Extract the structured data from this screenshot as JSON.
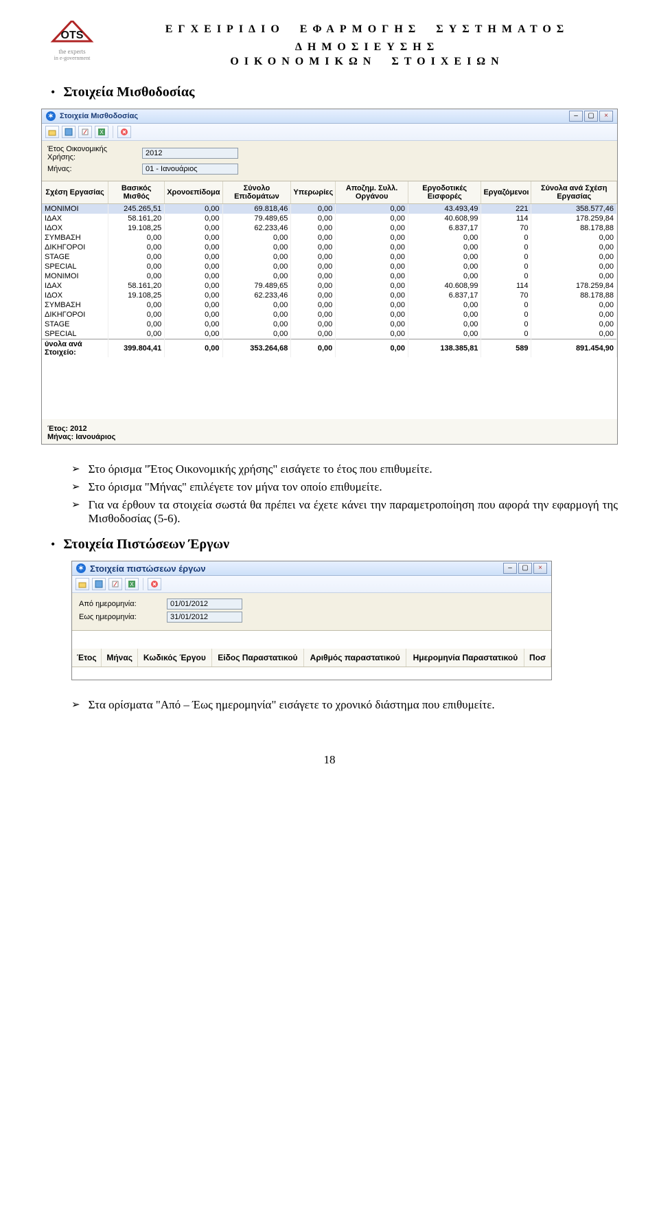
{
  "header": {
    "logo_sub1": "the experts",
    "logo_sub2": "in e-government",
    "title_line1": "ΕΓΧΕΙΡΙΔΙΟ ΕΦΑΡΜΟΓΗΣ ΣΥΣΤΗΜΑΤΟΣ ΔΗΜΟΣΙΕΥΣΗΣ",
    "title_line2": "ΟΙΚΟΝΟΜΙΚΩΝ ΣΤΟΙΧΕΙΩΝ"
  },
  "section1": {
    "heading": "Στοιχεία Μισθοδοσίας"
  },
  "screenshot1": {
    "title": "Στοιχεία Μισθοδοσίας",
    "form": {
      "year_label": "Έτος Οικονομικής Χρήσης:",
      "year_value": "2012",
      "month_label": "Μήνας:",
      "month_value": "01 - Ιανουάριος"
    },
    "columns": [
      "Σχέση Εργασίας",
      "Βασικός Μισθός",
      "Χρονοεπίδομα",
      "Σύνολο Επιδομάτων",
      "Υπερωρίες",
      "Αποζημ. Συλλ. Οργάνου",
      "Εργοδοτικές Εισφορές",
      "Εργαζόμενοι",
      "Σύνολα ανά Σχέση Εργασίας"
    ],
    "rows": [
      {
        "c": [
          "ΜΟΝΙΜΟΙ",
          "245.265,51",
          "0,00",
          "69.818,46",
          "0,00",
          "0,00",
          "43.493,49",
          "221",
          "358.577,46"
        ],
        "sel": true
      },
      {
        "c": [
          "ΙΔΑΧ",
          "58.161,20",
          "0,00",
          "79.489,65",
          "0,00",
          "0,00",
          "40.608,99",
          "114",
          "178.259,84"
        ]
      },
      {
        "c": [
          "ΙΔΟΧ",
          "19.108,25",
          "0,00",
          "62.233,46",
          "0,00",
          "0,00",
          "6.837,17",
          "70",
          "88.178,88"
        ]
      },
      {
        "c": [
          "ΣΥΜΒΑΣΗ",
          "0,00",
          "0,00",
          "0,00",
          "0,00",
          "0,00",
          "0,00",
          "0",
          "0,00"
        ]
      },
      {
        "c": [
          "ΔΙΚΗΓΟΡΟΙ",
          "0,00",
          "0,00",
          "0,00",
          "0,00",
          "0,00",
          "0,00",
          "0",
          "0,00"
        ]
      },
      {
        "c": [
          "STAGE",
          "0,00",
          "0,00",
          "0,00",
          "0,00",
          "0,00",
          "0,00",
          "0",
          "0,00"
        ]
      },
      {
        "c": [
          "SPECIAL",
          "0,00",
          "0,00",
          "0,00",
          "0,00",
          "0,00",
          "0,00",
          "0",
          "0,00"
        ]
      },
      {
        "c": [
          "ΜΟΝΙΜΟΙ",
          "0,00",
          "0,00",
          "0,00",
          "0,00",
          "0,00",
          "0,00",
          "0",
          "0,00"
        ]
      },
      {
        "c": [
          "ΙΔΑΧ",
          "58.161,20",
          "0,00",
          "79.489,65",
          "0,00",
          "0,00",
          "40.608,99",
          "114",
          "178.259,84"
        ]
      },
      {
        "c": [
          "ΙΔΟΧ",
          "19.108,25",
          "0,00",
          "62.233,46",
          "0,00",
          "0,00",
          "6.837,17",
          "70",
          "88.178,88"
        ]
      },
      {
        "c": [
          "ΣΥΜΒΑΣΗ",
          "0,00",
          "0,00",
          "0,00",
          "0,00",
          "0,00",
          "0,00",
          "0",
          "0,00"
        ]
      },
      {
        "c": [
          "ΔΙΚΗΓΟΡΟΙ",
          "0,00",
          "0,00",
          "0,00",
          "0,00",
          "0,00",
          "0,00",
          "0",
          "0,00"
        ]
      },
      {
        "c": [
          "STAGE",
          "0,00",
          "0,00",
          "0,00",
          "0,00",
          "0,00",
          "0,00",
          "0",
          "0,00"
        ]
      },
      {
        "c": [
          "SPECIAL",
          "0,00",
          "0,00",
          "0,00",
          "0,00",
          "0,00",
          "0,00",
          "0",
          "0,00"
        ]
      }
    ],
    "sum_label": "ύνολα ανά Στοιχείο:",
    "sum": [
      "399.804,41",
      "0,00",
      "353.264,68",
      "0,00",
      "0,00",
      "138.385,81",
      "589",
      "891.454,90"
    ],
    "footer": {
      "year": "Έτος: 2012",
      "month": "Μήνας: Ιανουάριος"
    }
  },
  "bullets1": [
    "Στο όρισμα \"Έτος Οικονομικής χρήσης\" εισάγετε το έτος που επιθυμείτε.",
    "Στο όρισμα \"Μήνας\" επιλέγετε τον μήνα τον οποίο επιθυμείτε.",
    "Για να έρθουν τα στοιχεία σωστά θα πρέπει να έχετε κάνει την παραμετροποίηση που αφορά την εφαρμογή της Μισθοδοσίας (5-6)."
  ],
  "section2": {
    "heading": "Στοιχεία Πιστώσεων Έργων"
  },
  "screenshot2": {
    "title": "Στοιχεία πιστώσεων έργων",
    "form": {
      "from_label": "Από ημερομηνία:",
      "from_value": "01/01/2012",
      "to_label": "Εως ημερομηνία:",
      "to_value": "31/01/2012"
    },
    "columns": [
      "Έτος",
      "Μήνας",
      "Κωδικός Έργου",
      "Είδος Παραστατικού",
      "Αριθμός παραστατικού",
      "Ημερομηνία Παραστατικού",
      "Ποσ"
    ]
  },
  "bullets2": [
    "Στα ορίσματα \"Από – Έως ημερομηνία\" εισάγετε το χρονικό διάστημα που επιθυμείτε."
  ],
  "page_number": "18"
}
